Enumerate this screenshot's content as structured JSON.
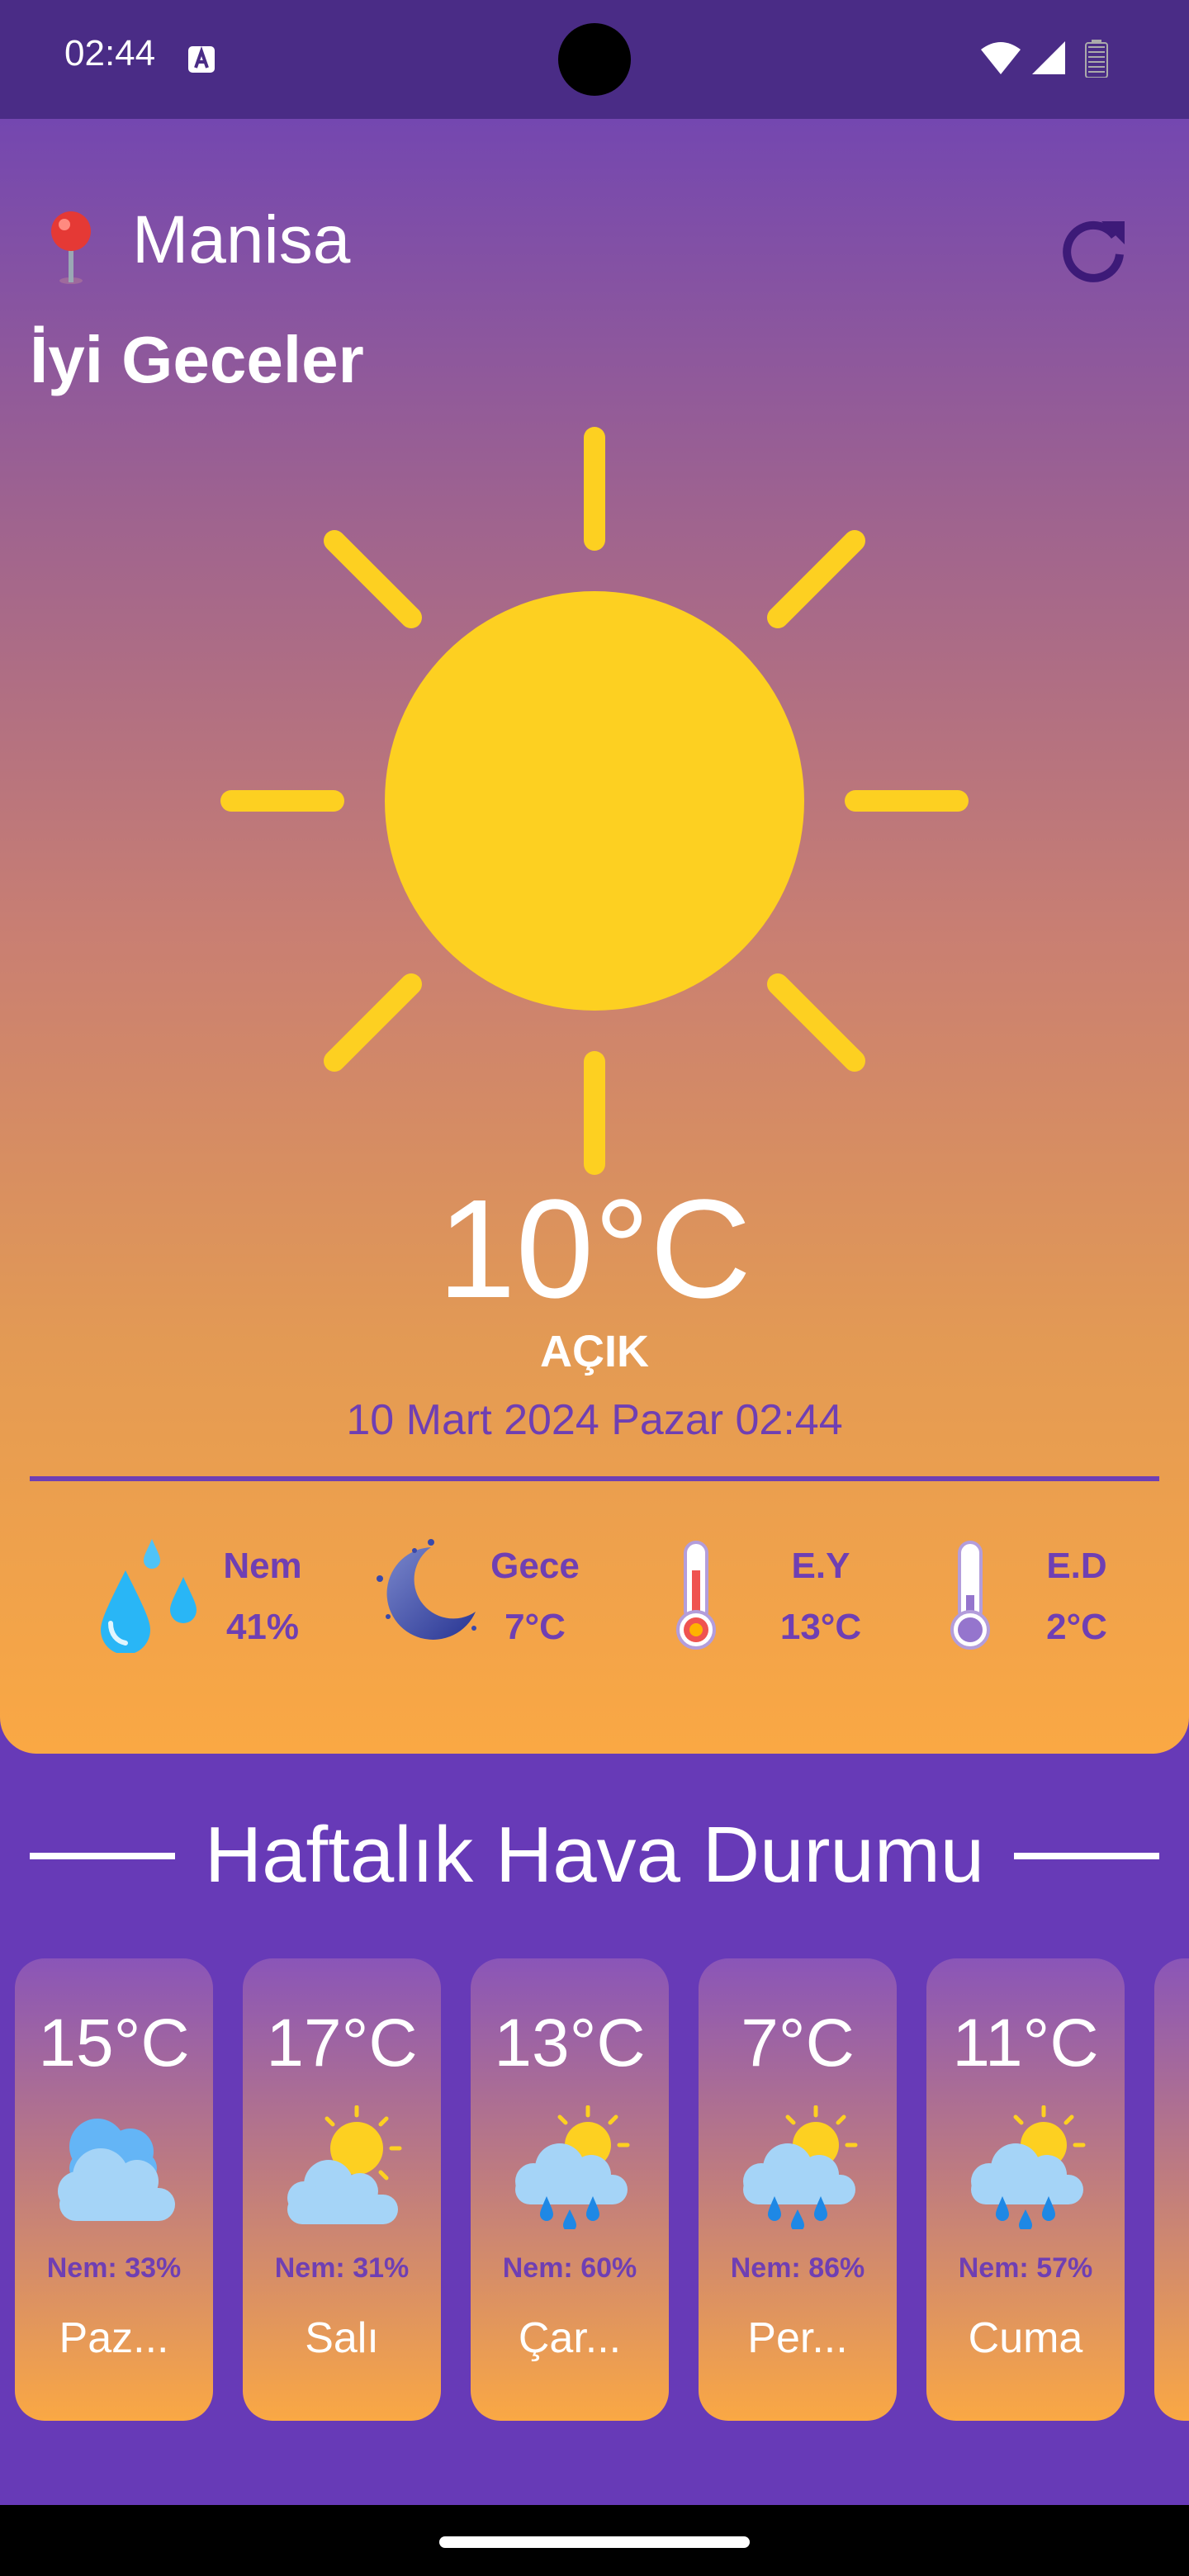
{
  "status_bar": {
    "time": "02:44"
  },
  "header": {
    "city": "Manisa",
    "greeting": "İyi Geceler"
  },
  "current": {
    "temperature": "10°C",
    "condition": "AÇIK",
    "datetime": "10 Mart 2024 Pazar 02:44",
    "stats": [
      {
        "label": "Nem",
        "value": "41%",
        "icon": "humidity-drops-icon"
      },
      {
        "label": "Gece",
        "value": "7°C",
        "icon": "moon-icon"
      },
      {
        "label": "E.Y",
        "value": "13°C",
        "icon": "thermometer-hot-icon"
      },
      {
        "label": "E.D",
        "value": "2°C",
        "icon": "thermometer-cold-icon"
      }
    ]
  },
  "weekly": {
    "title": "Haftalık Hava Durumu",
    "days": [
      {
        "temp": "15°C",
        "humidity": "Nem: 33%",
        "name": "Paz...",
        "icon": "cloudy-icon"
      },
      {
        "temp": "17°C",
        "humidity": "Nem: 31%",
        "name": "Salı",
        "icon": "partly-cloudy-icon"
      },
      {
        "temp": "13°C",
        "humidity": "Nem: 60%",
        "name": "Çar...",
        "icon": "rain-sun-icon"
      },
      {
        "temp": "7°C",
        "humidity": "Nem: 86%",
        "name": "Per...",
        "icon": "rain-sun-icon"
      },
      {
        "temp": "11°C",
        "humidity": "Nem: 57%",
        "name": "Cuma",
        "icon": "rain-sun-icon"
      }
    ]
  },
  "colors": {
    "accent": "#6f3fb3",
    "background": "#673ab7",
    "sun": "#fdd021",
    "gradient_bottom": "#faa844"
  }
}
